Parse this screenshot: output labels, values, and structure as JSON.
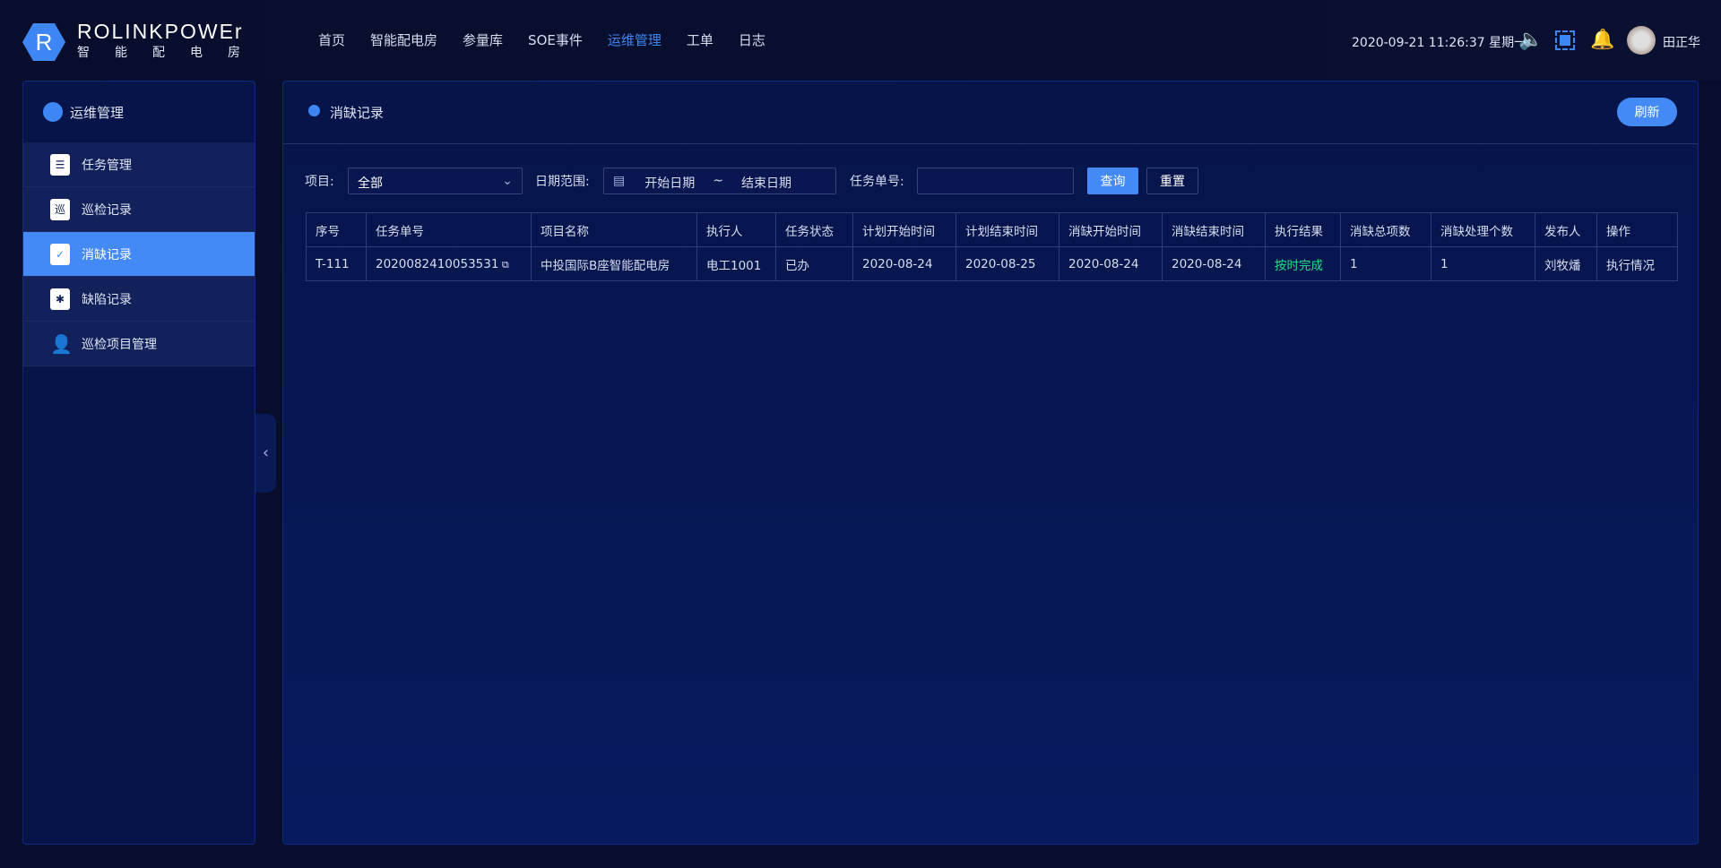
{
  "brand": {
    "name": "ROLINKPOWEr",
    "subtitle": "智能配电房",
    "logo_letter": "R"
  },
  "nav": [
    {
      "label": "首页"
    },
    {
      "label": "智能配电房"
    },
    {
      "label": "参量库"
    },
    {
      "label": "SOE事件"
    },
    {
      "label": "运维管理",
      "active": true
    },
    {
      "label": "工单"
    },
    {
      "label": "日志"
    }
  ],
  "header": {
    "datetime": "2020-09-21 11:26:37 星期一",
    "username": "田正华",
    "icons": [
      "mute-icon",
      "fullscreen-icon",
      "bell-icon"
    ]
  },
  "sidebar": {
    "title": "运维管理",
    "items": [
      {
        "label": "任务管理",
        "icon": "task-list-icon"
      },
      {
        "label": "巡检记录",
        "icon": "clipboard-icon"
      },
      {
        "label": "消缺记录",
        "icon": "doc-check-icon",
        "active": true
      },
      {
        "label": "缺陷记录",
        "icon": "bug-icon"
      },
      {
        "label": "巡检项目管理",
        "icon": "inspector-icon"
      }
    ]
  },
  "page": {
    "title": "消缺记录",
    "refresh": "刷新"
  },
  "filters": {
    "project_label": "项目:",
    "project_value": "全部",
    "date_label": "日期范围:",
    "date_start": "开始日期",
    "date_sep": "~",
    "date_end": "结束日期",
    "task_label": "任务单号:",
    "task_value": "",
    "query": "查询",
    "reset": "重置"
  },
  "table": {
    "columns": [
      "序号",
      "任务单号",
      "项目名称",
      "执行人",
      "任务状态",
      "计划开始时间",
      "计划结束时间",
      "消缺开始时间",
      "消缺结束时间",
      "执行结果",
      "消缺总项数",
      "消缺处理个数",
      "发布人",
      "操作"
    ],
    "rows": [
      [
        "T-111",
        "2020082410053531",
        "中投国际B座智能配电房",
        "电工1001",
        "已办",
        "2020-08-24",
        "2020-08-25",
        "2020-08-24",
        "2020-08-24",
        "按时完成",
        "1",
        "1",
        "刘牧燔",
        "执行情况"
      ]
    ]
  },
  "colors": {
    "accent": "#448af7",
    "success": "#1fe08a"
  }
}
